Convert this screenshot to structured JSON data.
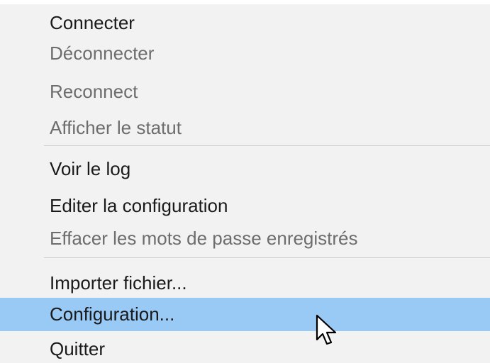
{
  "context_menu": {
    "items": [
      {
        "label": "Connecter",
        "enabled": true,
        "highlighted": false
      },
      {
        "label": "Déconnecter",
        "enabled": false,
        "highlighted": false
      },
      {
        "label": "Reconnect",
        "enabled": false,
        "highlighted": false
      },
      {
        "label": "Afficher le statut",
        "enabled": false,
        "highlighted": false
      },
      {
        "label": "Voir le log",
        "enabled": true,
        "highlighted": false
      },
      {
        "label": "Editer la configuration",
        "enabled": true,
        "highlighted": false
      },
      {
        "label": "Effacer les mots de passe enregistrés",
        "enabled": false,
        "highlighted": false
      },
      {
        "label": "Importer fichier...",
        "enabled": true,
        "highlighted": false
      },
      {
        "label": "Configuration...",
        "enabled": true,
        "highlighted": true
      },
      {
        "label": "Quitter",
        "enabled": true,
        "highlighted": false
      }
    ]
  },
  "colors": {
    "menu_background": "#f2f2f2",
    "enabled_text": "#1a1a1a",
    "disabled_text": "#6d6d6d",
    "highlight": "#99c9f5",
    "separator": "#cfcfcf"
  },
  "icons": {
    "cursor": "mouse-pointer-icon"
  }
}
